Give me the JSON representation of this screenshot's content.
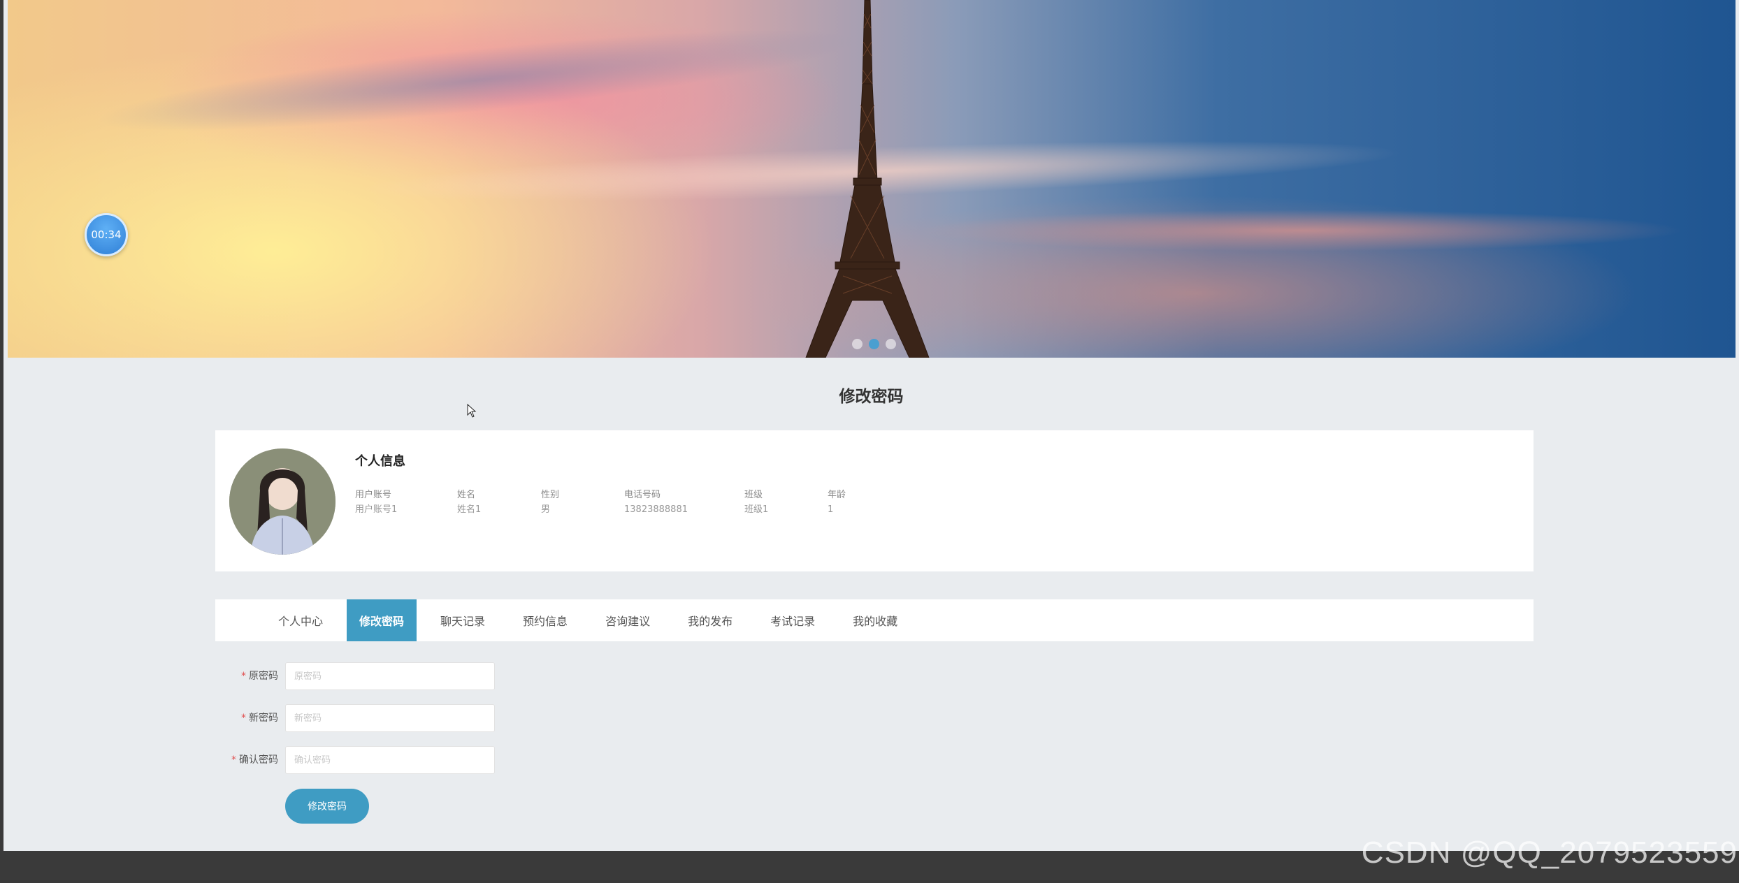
{
  "banner": {
    "timer_text": "00:34",
    "carousel_count": 3,
    "carousel_active_index": 1
  },
  "page_title": "修改密码",
  "profile": {
    "title": "个人信息",
    "fields": [
      {
        "label": "用户账号",
        "value": "用户账号1"
      },
      {
        "label": "姓名",
        "value": "姓名1"
      },
      {
        "label": "性别",
        "value": "男"
      },
      {
        "label": "电话号码",
        "value": "13823888881"
      },
      {
        "label": "班级",
        "value": "班级1"
      },
      {
        "label": "年龄",
        "value": "1"
      }
    ]
  },
  "tabs": [
    {
      "label": "个人中心",
      "active": false
    },
    {
      "label": "修改密码",
      "active": true
    },
    {
      "label": "聊天记录",
      "active": false
    },
    {
      "label": "预约信息",
      "active": false
    },
    {
      "label": "咨询建议",
      "active": false
    },
    {
      "label": "我的发布",
      "active": false
    },
    {
      "label": "考试记录",
      "active": false
    },
    {
      "label": "我的收藏",
      "active": false
    }
  ],
  "form": {
    "old_password": {
      "label": "原密码",
      "placeholder": "原密码",
      "value": ""
    },
    "new_password": {
      "label": "新密码",
      "placeholder": "新密码",
      "value": ""
    },
    "confirm_password": {
      "label": "确认密码",
      "placeholder": "确认密码",
      "value": ""
    },
    "required_mark": "*",
    "submit_label": "修改密码"
  },
  "watermark": "CSDN @QQ_2079523559",
  "colors": {
    "accent": "#3f9cc3",
    "page_bg": "#e9ecef",
    "required": "#e05050",
    "timer": "#2f7fd6"
  }
}
